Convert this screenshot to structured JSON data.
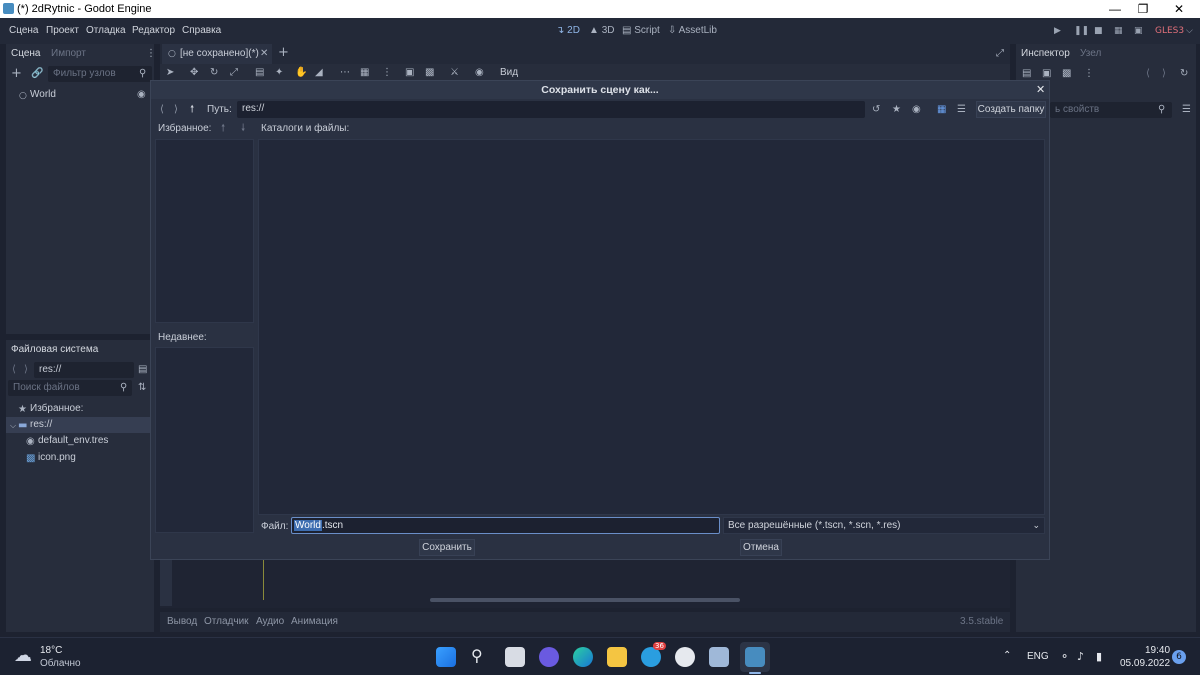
{
  "window": {
    "title": "(*) 2dRytnic - Godot Engine"
  },
  "menu": [
    "Сцена",
    "Проект",
    "Отладка",
    "Редактор",
    "Справка"
  ],
  "modes": [
    "2D",
    "3D",
    "Script",
    "AssetLib"
  ],
  "renderer": "GLES3",
  "scene_dock": {
    "tabs": [
      "Сцена",
      "Импорт"
    ],
    "filter_placeholder": "Фильтр узлов",
    "root_node": "World"
  },
  "editor_tab": "[не сохранено](*)",
  "toolbar": {
    "view_label": "Вид"
  },
  "filesystem_dock": {
    "title": "Файловая система",
    "path": "res://",
    "search_placeholder": "Поиск файлов",
    "favorites_label": "Избранное:",
    "items": [
      "res://",
      "default_env.tres",
      "icon.png"
    ]
  },
  "inspector_dock": {
    "tabs": [
      "Инспектор",
      "Узел"
    ],
    "filter_placeholder": "ь свойств"
  },
  "bottom_panel": {
    "tabs": [
      "Вывод",
      "Отладчик",
      "Аудио",
      "Анимация"
    ],
    "version": "3.5.stable"
  },
  "dialog": {
    "title": "Сохранить сцену как...",
    "path_label": "Путь:",
    "path_value": "res://",
    "create_folder": "Создать папку",
    "favorites_label": "Избранное:",
    "dirs_label": "Каталоги и файлы:",
    "recent_label": "Недавнее:",
    "file_label": "Файл:",
    "file_name_selected": "World",
    "file_ext": ".tscn",
    "filter": "Все разрешённые (*.tscn, *.scn, *.res)",
    "save": "Сохранить",
    "cancel": "Отмена"
  },
  "taskbar": {
    "weather_temp": "18°C",
    "weather_desc": "Облачно",
    "lang": "ENG",
    "time": "19:40",
    "date": "05.09.2022",
    "notif_count": "6",
    "telegram_badge": "36"
  }
}
